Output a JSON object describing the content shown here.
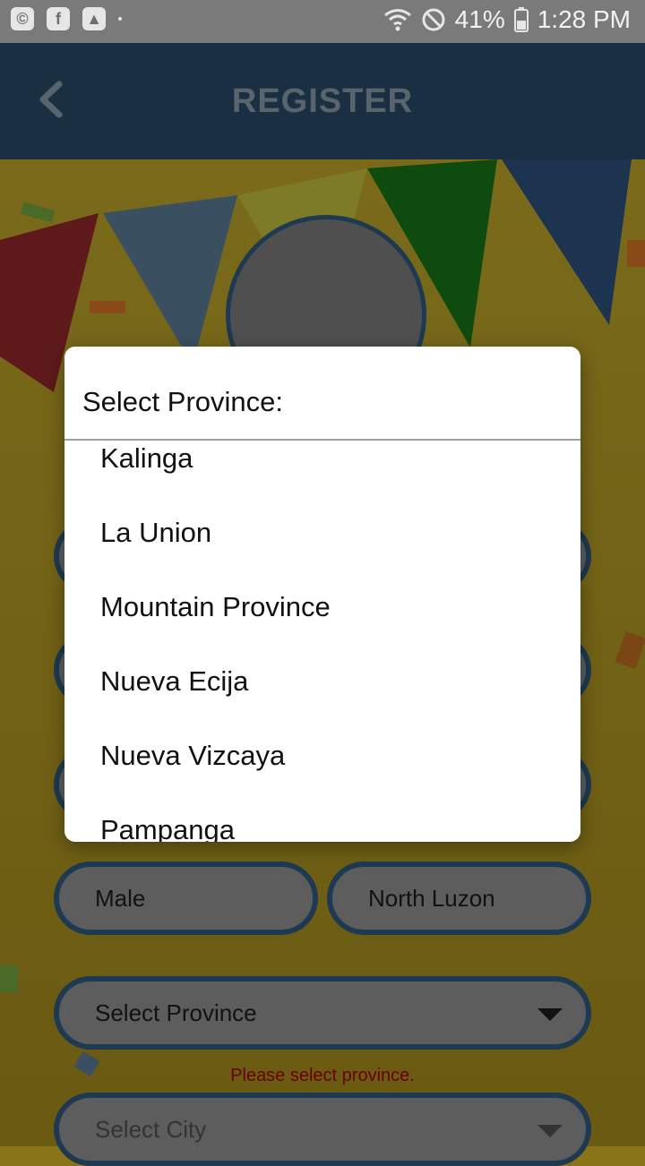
{
  "status": {
    "battery": "41%",
    "time": "1:28 PM"
  },
  "header": {
    "title": "REGISTER"
  },
  "form": {
    "gender": "Male",
    "region": "North Luzon",
    "province_placeholder": "Select Province",
    "province_error": "Please select province.",
    "city_placeholder": "Select City"
  },
  "dialog": {
    "title": "Select Province:",
    "options": [
      "Kalinga",
      "La Union",
      "Mountain Province",
      "Nueva Ecija",
      "Nueva Vizcaya",
      "Pampanga"
    ]
  }
}
